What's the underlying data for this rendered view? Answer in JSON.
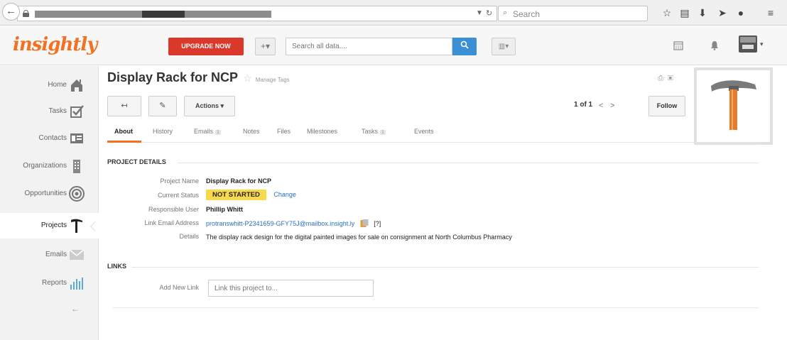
{
  "browser": {
    "search_placeholder": "Search",
    "icons": [
      "back-icon",
      "lock-icon",
      "reload-icon",
      "search-icon",
      "bookmark-star-icon",
      "reading-list-icon",
      "download-icon",
      "send-icon",
      "chat-icon",
      "menu-icon"
    ]
  },
  "header": {
    "logo": "insightly",
    "upgrade_label": "UPGRADE NOW",
    "plus_label": "+▾",
    "search_placeholder": "Search all data....",
    "search_button": "🔍",
    "view_label": "▥▾",
    "colors": {
      "brand": "#f27123",
      "upgrade": "#d9382b",
      "search": "#3b8fd4"
    }
  },
  "sidebar": {
    "items": [
      {
        "label": "Home",
        "icon": "home-icon"
      },
      {
        "label": "Tasks",
        "icon": "tasks-icon"
      },
      {
        "label": "Contacts",
        "icon": "contacts-icon"
      },
      {
        "label": "Organizations",
        "icon": "organizations-icon"
      },
      {
        "label": "Opportunities",
        "icon": "opportunities-icon"
      },
      {
        "label": "Projects",
        "icon": "projects-icon",
        "active": true
      },
      {
        "label": "Emails",
        "icon": "emails-icon"
      },
      {
        "label": "Reports",
        "icon": "reports-icon"
      }
    ],
    "collapse": "←"
  },
  "page": {
    "title": "Display Rack for NCP",
    "star": "☆",
    "manage_tags": "Manage Tags",
    "actions_label": "Actions ▾",
    "pager": "1 of 1",
    "prev": "<",
    "next": ">",
    "follow_label": "Follow"
  },
  "tabs": [
    {
      "label": "About",
      "active": true
    },
    {
      "label": "History"
    },
    {
      "label": "Emails",
      "badge": "1"
    },
    {
      "label": "Notes"
    },
    {
      "label": "Files"
    },
    {
      "label": "Milestones"
    },
    {
      "label": "Tasks",
      "badge": "1"
    },
    {
      "label": "Events"
    }
  ],
  "project_details": {
    "section_title": "PROJECT DETAILS",
    "project_name_label": "Project Name",
    "project_name": "Display Rack for NCP",
    "status_label": "Current Status",
    "status": "NOT STARTED",
    "change_label": "Change",
    "user_label": "Responsible User",
    "user": "Phillip Whitt",
    "email_label": "Link Email Address",
    "email": "protranswhitt-P2341659-GFY75J@mailbox.insight.ly",
    "help": "[?]",
    "details_label": "Details",
    "details": "The display rack design for the digital painted images for sale on consignment at North Columbus Pharmacy"
  },
  "links": {
    "section_title": "LINKS",
    "add_label": "Add New Link",
    "add_placeholder": "Link this project to..."
  }
}
